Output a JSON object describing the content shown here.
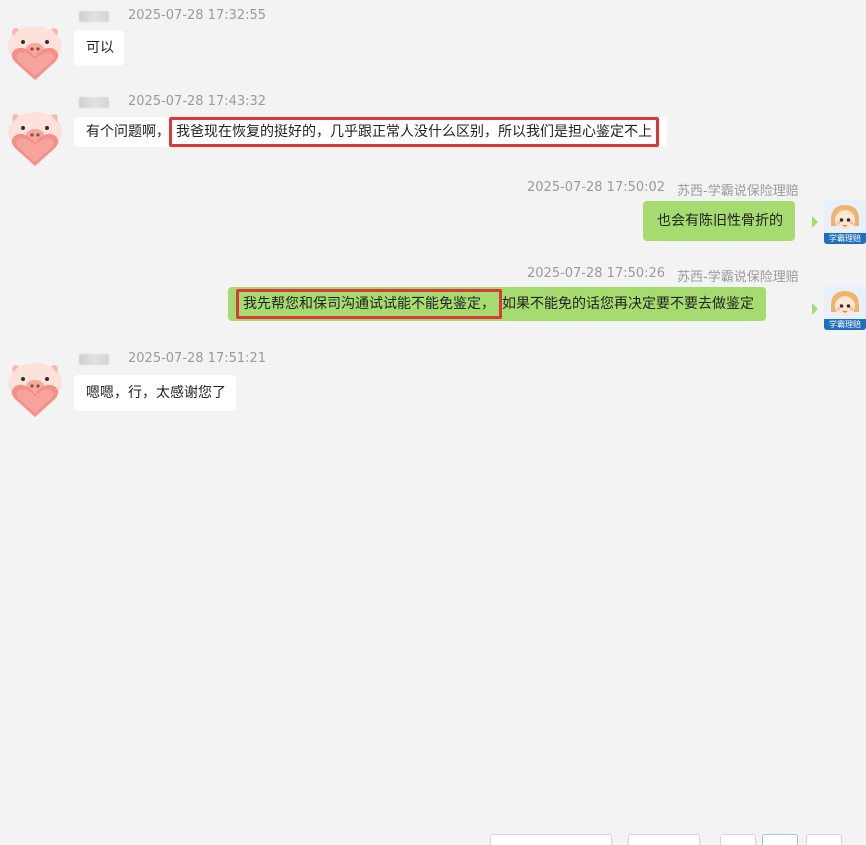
{
  "messages": [
    {
      "id": "m1",
      "direction": "incoming",
      "sender": "",
      "timestamp": "2025-07-28 17:32:55",
      "text": "可以",
      "avatar": "pig-heart-avatar"
    },
    {
      "id": "m2",
      "direction": "incoming",
      "sender": "",
      "timestamp": "2025-07-28 17:43:32",
      "text_prefix": "有个问题啊，",
      "text_highlight": "我爸现在恢复的挺好的，几乎跟正常人没什么区别，所以我们是担心鉴定不上",
      "avatar": "pig-heart-avatar"
    },
    {
      "id": "m3",
      "direction": "outgoing",
      "sender": "苏西-学霸说保险理赔",
      "timestamp": "2025-07-28 17:50:02",
      "text": "也会有陈旧性骨折的",
      "avatar": "agent-cartoon-avatar",
      "avatar_label": "学霸理赔"
    },
    {
      "id": "m4",
      "direction": "outgoing",
      "sender": "苏西-学霸说保险理赔",
      "timestamp": "2025-07-28 17:50:26",
      "text_highlight": "我先帮您和保司沟通试试能不能免鉴定，",
      "text_suffix": "如果不能免的话您再决定要不要去做鉴定",
      "avatar": "agent-cartoon-avatar",
      "avatar_label": "学霸理赔"
    },
    {
      "id": "m5",
      "direction": "incoming",
      "sender": "",
      "timestamp": "2025-07-28 17:51:21",
      "text": "嗯嗯，行，太感谢您了",
      "avatar": "pig-heart-avatar"
    }
  ],
  "colors": {
    "background": "#f3f3f3",
    "incoming_bubble": "#ffffff",
    "outgoing_bubble": "#a6dc6f",
    "highlight_border": "#d9393a",
    "meta_text": "#9a9a9a"
  }
}
